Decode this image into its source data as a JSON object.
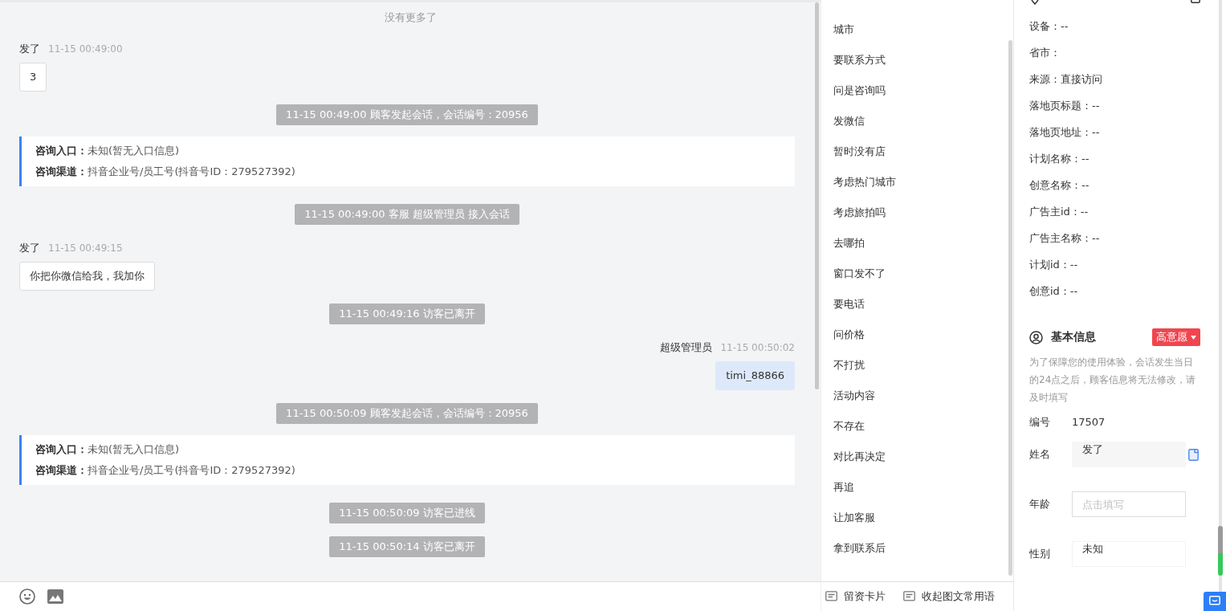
{
  "chat": {
    "notice": "没有更多了",
    "messages": [
      {
        "kind": "visitor",
        "sender": "发了",
        "time": "11-15 00:49:00",
        "text": "3"
      },
      {
        "kind": "system",
        "text": "11-15 00:49:00 顾客发起会话，会话编号：20956"
      },
      {
        "kind": "entry",
        "lines": [
          {
            "label": "咨询入口：",
            "value": "未知(暂无入口信息)"
          },
          {
            "label": "咨询渠道：",
            "value": "抖音企业号/员工号(抖音号ID：279527392)"
          }
        ]
      },
      {
        "kind": "system",
        "text": "11-15 00:49:00 客服 超级管理员 接入会话"
      },
      {
        "kind": "visitor",
        "sender": "发了",
        "time": "11-15 00:49:15",
        "text": "你把你微信给我，我加你"
      },
      {
        "kind": "system",
        "text": "11-15 00:49:16 访客已离开"
      },
      {
        "kind": "agent",
        "sender": "超级管理员",
        "time": "11-15 00:50:02",
        "text": "timi_88866"
      },
      {
        "kind": "system",
        "text": "11-15 00:50:09 顾客发起会话，会话编号：20956"
      },
      {
        "kind": "entry",
        "lines": [
          {
            "label": "咨询入口：",
            "value": "未知(暂无入口信息)"
          },
          {
            "label": "咨询渠道：",
            "value": "抖音企业号/员工号(抖音号ID：279527392)"
          }
        ]
      },
      {
        "kind": "system",
        "text": "11-15 00:50:09 访客已进线"
      },
      {
        "kind": "system",
        "text": "11-15 00:50:14 访客已离开"
      }
    ]
  },
  "quick_phrases": {
    "items": [
      "城市",
      "要联系方式",
      "问是咨询吗",
      "发微信",
      "暂时没有店",
      "考虑热门城市",
      "考虑旅拍吗",
      "去哪拍",
      "窗口发不了",
      "要电话",
      "问价格",
      "不打扰",
      "活动内容",
      "不存在",
      "对比再决定",
      "再追",
      "让加客服",
      "拿到联系后"
    ],
    "actions": [
      "留资卡片",
      "收起图文常用语"
    ]
  },
  "source_info": {
    "lines": [
      "设备：--",
      "省市：",
      "来源：直接访问",
      "落地页标题：--",
      "落地页地址：--",
      "计划名称：--",
      "创意名称：--",
      "广告主id：--",
      "广告主名称：--",
      "计划id：--",
      "创意id：--"
    ]
  },
  "basic_info": {
    "title": "基本信息",
    "intent": "高意愿",
    "note": "为了保障您的使用体验，会话发生当日的24点之后，顾客信息将无法修改，请及时填写",
    "fields": [
      {
        "kind": "text",
        "label": "编号",
        "value": "17507"
      },
      {
        "kind": "readonly",
        "label": "姓名",
        "value": "发了"
      },
      {
        "kind": "input",
        "label": "年龄",
        "placeholder": "点击填写"
      },
      {
        "kind": "select",
        "label": "性别",
        "value": "未知"
      }
    ]
  }
}
